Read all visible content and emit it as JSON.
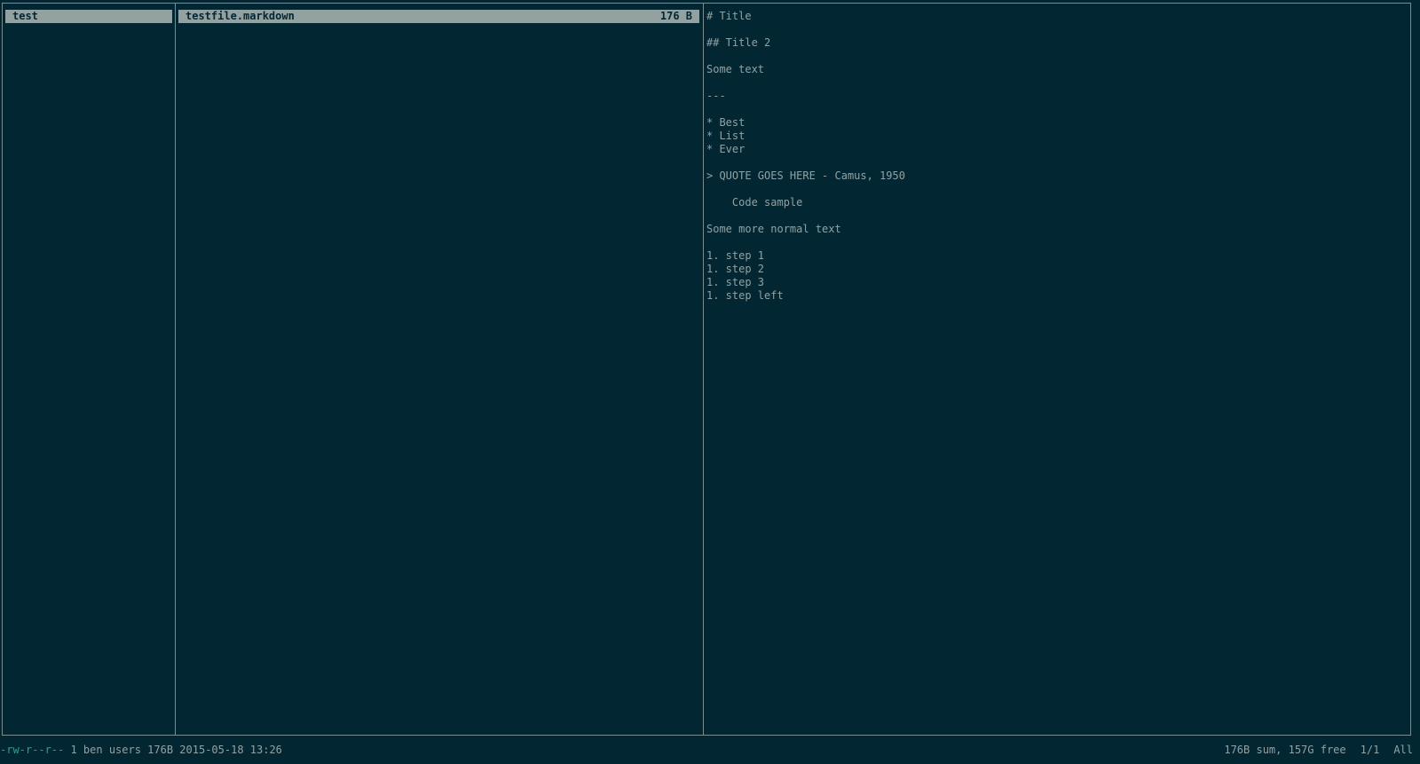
{
  "parent_pane": {
    "items": [
      {
        "name": "test"
      }
    ]
  },
  "current_pane": {
    "items": [
      {
        "name": "testfile.markdown",
        "size": "176 B"
      }
    ]
  },
  "preview": {
    "lines": [
      "# Title",
      "",
      "## Title 2",
      "",
      "Some text",
      "",
      "---",
      "",
      "* Best",
      "* List",
      "* Ever",
      "",
      "> QUOTE GOES HERE - Camus, 1950",
      "",
      "    Code sample",
      "",
      "Some more normal text",
      "",
      "1. step 1",
      "1. step 2",
      "1. step 3",
      "1. step left"
    ]
  },
  "status": {
    "permissions": "-rw-r--r--",
    "file_info": " 1 ben users 176B 2015-05-18 13:26",
    "disk_summary": "176B sum, 157G free",
    "position": "1/1",
    "scroll": "All"
  },
  "colors": {
    "background": "#022733",
    "foreground": "#93a1a1",
    "border": "#7c8b8e",
    "permissions": "#2aa198"
  }
}
